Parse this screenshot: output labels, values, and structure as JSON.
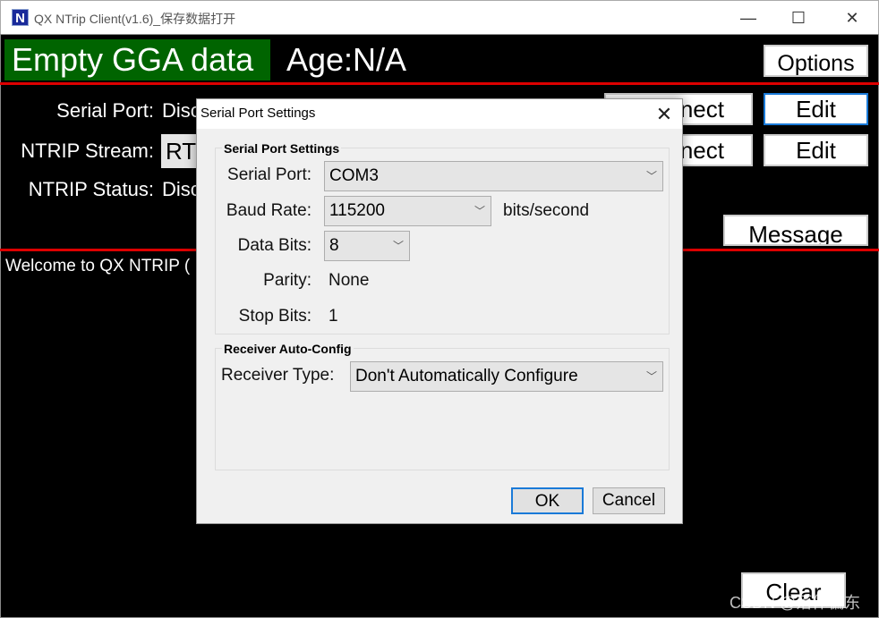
{
  "window": {
    "title": "QX NTrip Client(v1.6)_保存数据打开",
    "icon_letter": "N",
    "minimize": "—",
    "maximize": "☐",
    "close": "✕"
  },
  "header": {
    "gga_status": "Empty GGA data",
    "age": "Age:N/A",
    "options": "Options",
    "gga_color": "#006400"
  },
  "status": {
    "serial_port_label": "Serial Port:",
    "serial_port_value": "Disc",
    "ntrip_stream_label": "NTRIP Stream:",
    "ntrip_stream_value": "RT",
    "ntrip_status_label": "NTRIP Status:",
    "ntrip_status_value": "Disc"
  },
  "buttons": {
    "connect1": "nect",
    "edit1": "Edit",
    "connect2": "nect",
    "edit2": "Edit",
    "message": "Message",
    "clear": "Clear"
  },
  "log": {
    "text": "Welcome to QX NTRIP ("
  },
  "watermark": "CSDN @落体偏东",
  "dialog": {
    "title": "Serial Port Settings",
    "close": "✕",
    "group1": {
      "title": "Serial Port Settings",
      "serial_port_label": "Serial Port:",
      "serial_port": "COM3",
      "baud_label": "Baud Rate:",
      "baud": "115200",
      "baud_unit": "bits/second",
      "data_bits_label": "Data Bits:",
      "data_bits": "8",
      "parity_label": "Parity:",
      "parity": "None",
      "stop_bits_label": "Stop Bits:",
      "stop_bits": "1"
    },
    "group2": {
      "title": "Receiver Auto-Config",
      "receiver_type_label": "Receiver Type:",
      "receiver_type": "Don't Automatically Configure"
    },
    "ok": "OK",
    "cancel": "Cancel"
  }
}
